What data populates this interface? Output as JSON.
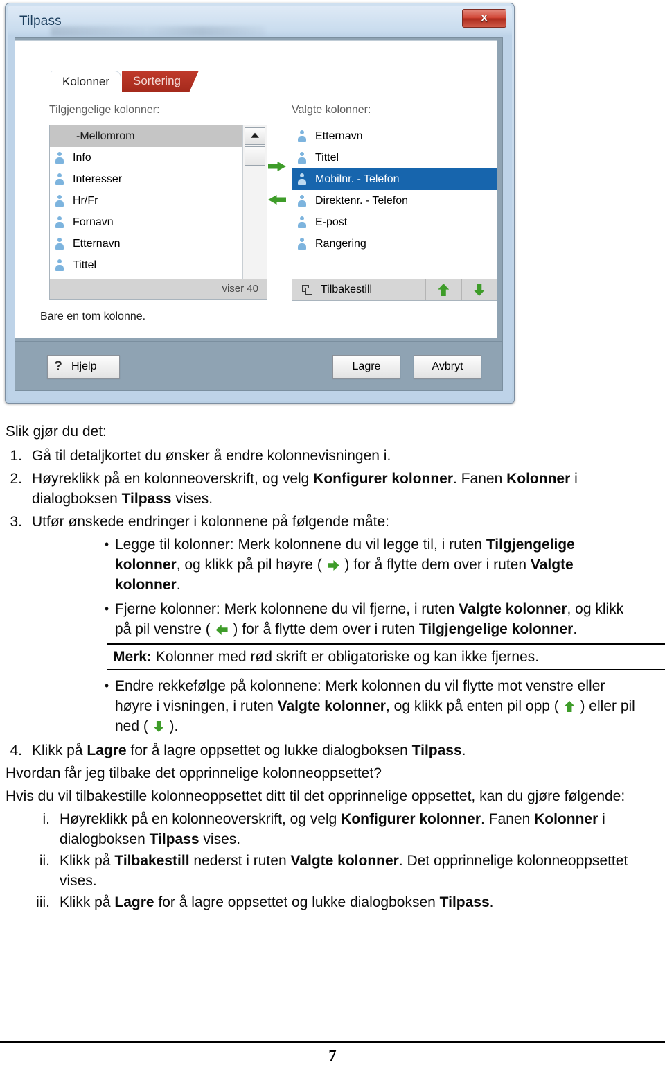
{
  "dialog": {
    "title": "Tilpass",
    "close_label": "X",
    "tabs": [
      {
        "label": "Kolonner",
        "active": true
      },
      {
        "label": "Sortering",
        "active": false
      }
    ],
    "available": {
      "label": "Tilgjengelige kolonner:",
      "items": [
        {
          "label": "-Mellomrom",
          "type": "header"
        },
        {
          "label": "Info",
          "type": "item"
        },
        {
          "label": "Interesser",
          "type": "item"
        },
        {
          "label": "Hr/Fr",
          "type": "item"
        },
        {
          "label": "Fornavn",
          "type": "item"
        },
        {
          "label": "Etternavn",
          "type": "item"
        },
        {
          "label": "Tittel",
          "type": "item"
        }
      ],
      "footer": "viser  40"
    },
    "selected": {
      "label": "Valgte kolonner:",
      "items": [
        {
          "label": "Etternavn",
          "selected": false
        },
        {
          "label": "Tittel",
          "selected": false
        },
        {
          "label": "Mobilnr. - Telefon",
          "selected": true
        },
        {
          "label": "Direktenr. - Telefon",
          "selected": false
        },
        {
          "label": "E-post",
          "selected": false
        },
        {
          "label": "Rangering",
          "selected": false
        }
      ],
      "reset_label": "Tilbakestill"
    },
    "hint": "Bare en tom kolonne.",
    "buttons": {
      "help": "Hjelp",
      "save": "Lagre",
      "cancel": "Avbryt"
    },
    "colors": {
      "accent_green": "#3e9c29",
      "selection_blue": "#1765ad",
      "tab_red": "#a52a1c",
      "close_red": "#cf4433"
    }
  },
  "doc": {
    "heading": "Slik gjør du det:",
    "steps": [
      {
        "num": "1.",
        "parts": [
          {
            "t": "Gå til detaljkortet du ønsker å endre kolonnevisningen i.",
            "b": false
          }
        ]
      },
      {
        "num": "2.",
        "parts": [
          {
            "t": "Høyreklikk på en kolonneoverskrift, og velg ",
            "b": false
          },
          {
            "t": "Konfigurer kolonner",
            "b": true
          },
          {
            "t": ". Fanen ",
            "b": false
          },
          {
            "t": "Kolonner",
            "b": true
          },
          {
            "t": " i dialogboksen ",
            "b": false
          },
          {
            "t": "Tilpass",
            "b": true
          },
          {
            "t": " vises.",
            "b": false
          }
        ]
      },
      {
        "num": "3.",
        "parts": [
          {
            "t": "Utfør ønskede endringer i kolonnene på følgende måte:",
            "b": false
          }
        ]
      }
    ],
    "bullets": [
      {
        "parts": [
          {
            "t": "Legge til kolonner: Merk kolonnene du vil legge til, i ruten ",
            "b": false
          },
          {
            "t": "Tilgjengelige kolonner",
            "b": true
          },
          {
            "t": ", og klikk på pil høyre ( ",
            "b": false
          },
          {
            "icon": "arrow-right-icon"
          },
          {
            "t": " ) for å flytte dem over i ruten ",
            "b": false
          },
          {
            "t": "Valgte kolonner",
            "b": true
          },
          {
            "t": ".",
            "b": false
          }
        ]
      },
      {
        "parts": [
          {
            "t": "Fjerne kolonner: Merk kolonnene du vil fjerne, i ruten ",
            "b": false
          },
          {
            "t": "Valgte kolonner",
            "b": true
          },
          {
            "t": ", og klikk på pil venstre ( ",
            "b": false
          },
          {
            "icon": "arrow-left-icon"
          },
          {
            "t": " ) for å flytte dem over i ruten ",
            "b": false
          },
          {
            "t": "Tilgjengelige kolonner",
            "b": true
          },
          {
            "t": ".",
            "b": false
          }
        ]
      }
    ],
    "note": {
      "parts": [
        {
          "t": "Merk:",
          "b": true
        },
        {
          "t": " Kolonner med rød skrift er obligatoriske og kan ikke fjernes.",
          "b": false
        }
      ]
    },
    "bullets2": [
      {
        "parts": [
          {
            "t": "Endre rekkefølge på kolonnene: Merk kolonnen du vil flytte mot venstre eller høyre i visningen, i ruten ",
            "b": false
          },
          {
            "t": "Valgte kolonner",
            "b": true
          },
          {
            "t": ", og klikk på enten pil opp ( ",
            "b": false
          },
          {
            "icon": "arrow-up-icon"
          },
          {
            "t": " ) eller pil ned ( ",
            "b": false
          },
          {
            "icon": "arrow-down-icon"
          },
          {
            "t": " ).",
            "b": false
          }
        ]
      }
    ],
    "step4": {
      "num": "4.",
      "parts": [
        {
          "t": "Klikk på ",
          "b": false
        },
        {
          "t": "Lagre",
          "b": true
        },
        {
          "t": " for å lagre oppsettet og lukke dialogboksen ",
          "b": false
        },
        {
          "t": "Tilpass",
          "b": true
        },
        {
          "t": ".",
          "b": false
        }
      ]
    },
    "question": "Hvordan får jeg tilbake det opprinnelige kolonneoppsettet?",
    "intro": "Hvis du vil tilbakestille kolonneoppsettet ditt til det opprinnelige oppsettet, kan du gjøre følgende:",
    "roman": [
      {
        "num": "i.",
        "parts": [
          {
            "t": "Høyreklikk på en kolonneoverskrift, og velg ",
            "b": false
          },
          {
            "t": "Konfigurer kolonner",
            "b": true
          },
          {
            "t": ". Fanen ",
            "b": false
          },
          {
            "t": "Kolonner",
            "b": true
          },
          {
            "t": " i dialogboksen ",
            "b": false
          },
          {
            "t": "Tilpass",
            "b": true
          },
          {
            "t": " vises.",
            "b": false
          }
        ]
      },
      {
        "num": "ii.",
        "parts": [
          {
            "t": "Klikk på ",
            "b": false
          },
          {
            "t": "Tilbakestill",
            "b": true
          },
          {
            "t": " nederst i ruten ",
            "b": false
          },
          {
            "t": "Valgte kolonner",
            "b": true
          },
          {
            "t": ". Det opprinnelige kolonneoppsettet vises.",
            "b": false
          }
        ]
      },
      {
        "num": "iii.",
        "parts": [
          {
            "t": "Klikk på ",
            "b": false
          },
          {
            "t": "Lagre",
            "b": true
          },
          {
            "t": " for å lagre oppsettet og lukke dialogboksen ",
            "b": false
          },
          {
            "t": "Tilpass",
            "b": true
          },
          {
            "t": ".",
            "b": false
          }
        ]
      }
    ],
    "page_number": "7"
  }
}
